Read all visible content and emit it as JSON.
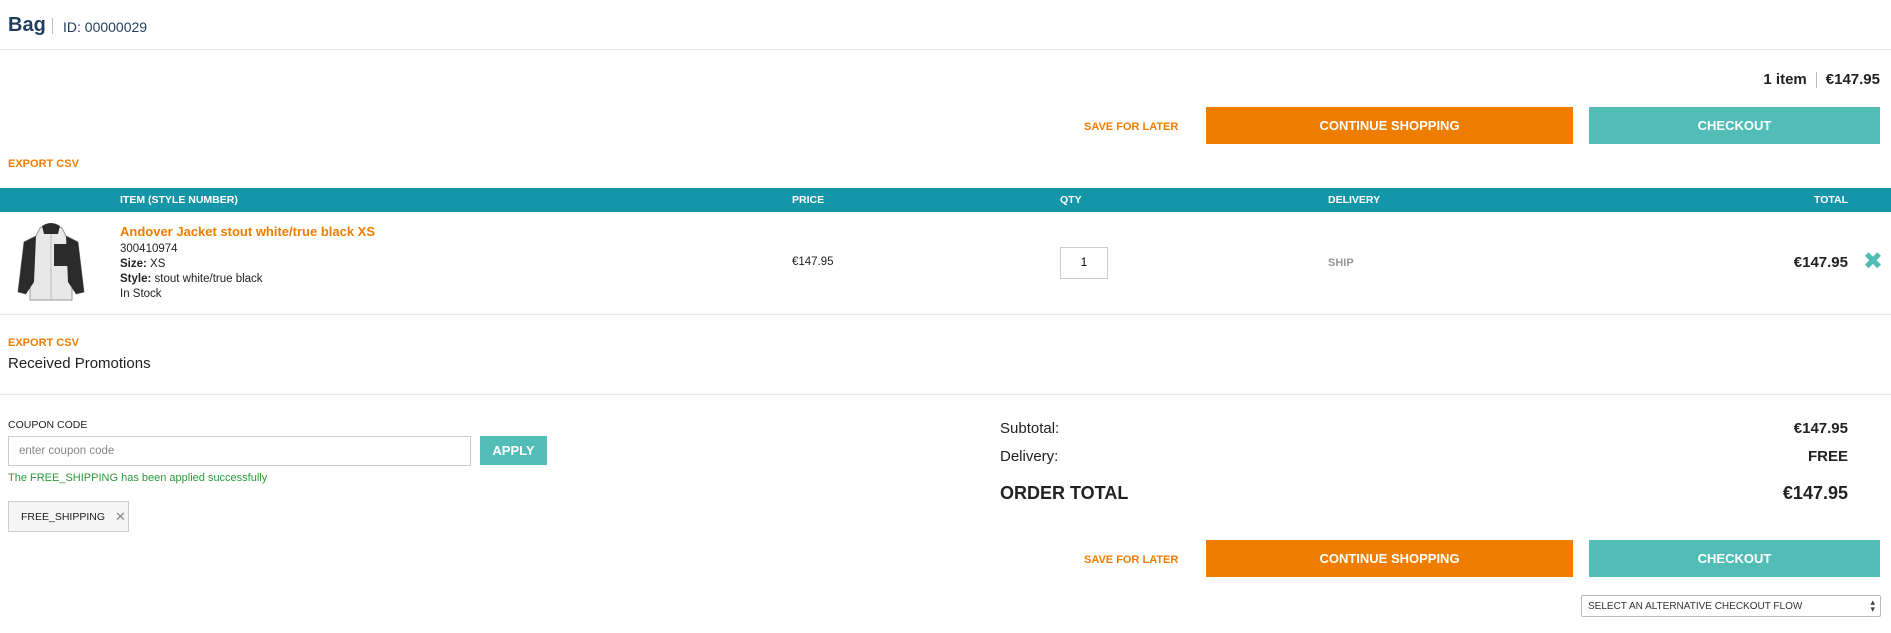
{
  "header": {
    "title": "Bag",
    "bag_id": "ID: 00000029"
  },
  "summary": {
    "items": "1 item",
    "amount": "€147.95"
  },
  "actions": {
    "save_for_later": "SAVE FOR LATER",
    "continue_shopping": "CONTINUE SHOPPING",
    "checkout": "CHECKOUT",
    "export_csv": "EXPORT CSV"
  },
  "table": {
    "headers": {
      "item": "ITEM (STYLE NUMBER)",
      "price": "PRICE",
      "qty": "QTY",
      "delivery": "DELIVERY",
      "total": "TOTAL"
    },
    "rows": [
      {
        "name": "Andover Jacket stout white/true black XS",
        "style_number": "300410974",
        "size_label": "Size:",
        "size": "XS",
        "style_label": "Style:",
        "style": "stout white/true black",
        "stock": "In Stock",
        "price": "€147.95",
        "qty": "1",
        "delivery": "SHIP",
        "total": "€147.95"
      }
    ]
  },
  "promotions": {
    "title": "Received Promotions"
  },
  "coupon": {
    "label": "COUPON CODE",
    "placeholder": "enter coupon code",
    "apply": "APPLY",
    "message": "The FREE_SHIPPING has been applied successfully",
    "applied_code": "FREE_SHIPPING"
  },
  "totals": {
    "subtotal_label": "Subtotal:",
    "subtotal": "€147.95",
    "delivery_label": "Delivery:",
    "delivery": "FREE",
    "order_total_label": "ORDER TOTAL",
    "order_total": "€147.95"
  },
  "alt_checkout": {
    "selected": "SELECT AN ALTERNATIVE CHECKOUT FLOW"
  },
  "colors": {
    "accent_orange": "#ef7d00",
    "accent_teal": "#52bdb6",
    "table_header": "#1595a8",
    "brand_navy": "#1f3d5c",
    "success_green": "#2a9a3a"
  },
  "icons": {
    "remove": "close-x-icon",
    "chip_remove": "close-icon",
    "select_arrows": "sort-arrows-icon",
    "product": "jacket-image"
  }
}
